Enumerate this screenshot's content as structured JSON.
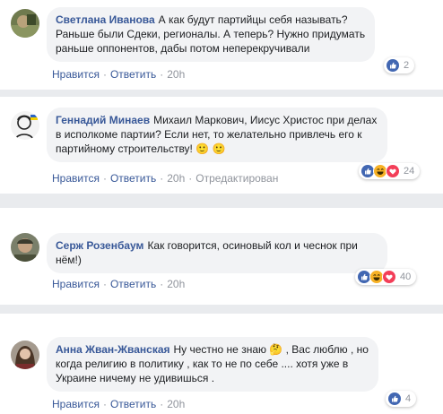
{
  "comments": [
    {
      "author": "Светлана Иванова",
      "text": "А как будут партийцы себя называть? Раньше были Сдеки, регионалы. А теперь? Нужно придумать раньше оппонентов, дабы потом неперекручивали",
      "like_label": "Нравится",
      "reply_label": "Ответить",
      "time": "20h",
      "reaction_count": "2",
      "reactions": [
        "like-icon"
      ]
    },
    {
      "author": "Геннадий Минаев",
      "text": "Михаил Маркович, Иисус Христос при делах в исполкоме партии? Если нет, то желательно привлечь его к партийному строительству! 🙂 🙂",
      "like_label": "Нравится",
      "reply_label": "Ответить",
      "time": "20h",
      "edited_label": "Отредактирован",
      "reaction_count": "24",
      "reactions": [
        "like-icon",
        "haha-icon",
        "love-icon"
      ]
    },
    {
      "author": "Серж Розенбаум",
      "text": "Как говорится, осиновый кол и чеснок при нём!)",
      "like_label": "Нравится",
      "reply_label": "Ответить",
      "time": "20h",
      "reaction_count": "40",
      "reactions": [
        "like-icon",
        "haha-icon",
        "love-icon"
      ]
    },
    {
      "author": "Анна Жван-Жванская",
      "text": "Ну честно не знаю 🤔 , Вас люблю , но когда религию в политику , как то не по себе .... хотя уже в Украине ничему не удивишься .",
      "like_label": "Нравится",
      "reply_label": "Ответить",
      "time": "20h",
      "reaction_count": "4",
      "reactions": [
        "like-icon"
      ]
    }
  ],
  "separator": "·",
  "colors": {
    "link": "#385898",
    "bubble": "#f2f3f5",
    "meta": "#90949c",
    "like": "#4267b2",
    "love": "#f33e58",
    "haha": "#f7b125",
    "divider": "#e9ebee"
  }
}
